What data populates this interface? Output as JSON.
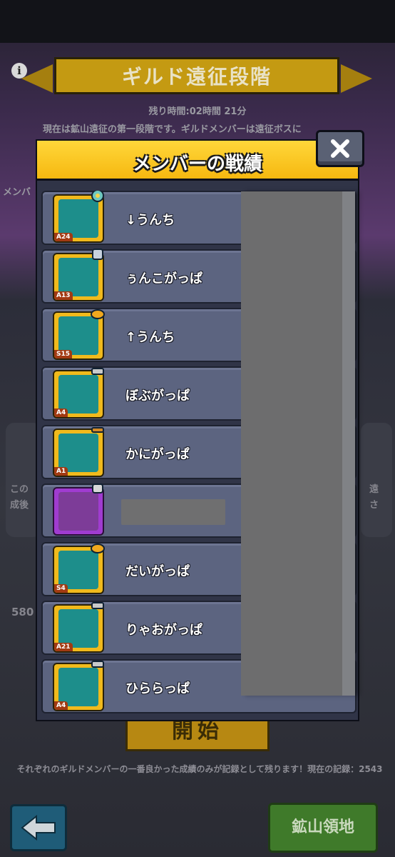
{
  "background": {
    "title": "ギルド遠征段階",
    "time_left": "残り時間:02時間 21分",
    "description": "現在は鉱山遠征の第一段階です。ギルドメンバーは遠征ボスに",
    "side_text": "メンバ",
    "side_text_left": "この\n成後",
    "side_text_right": "遠\nさ",
    "number": "580",
    "start_button": "開始",
    "note": "それぞれのギルドメンバーの一番良かった成績のみが記録として残ります！現在の記録：2543",
    "mine_button": "鉱山領地"
  },
  "modal": {
    "title": "メンバーの戦績",
    "members": [
      {
        "name": "↓うんち",
        "level": "A24",
        "badge": "gear-badge"
      },
      {
        "name": "ぅんこがっぱ",
        "level": "A13",
        "badge": "scroll-badge"
      },
      {
        "name": "↑うんち",
        "level": "S15",
        "badge": "pot-badge"
      },
      {
        "name": "ぼぶがっぱ",
        "level": "A4",
        "badge": "tool-badge"
      },
      {
        "name": "かにがっぱ",
        "level": "A1",
        "badge": "wrench-badge"
      },
      {
        "name": "",
        "level": "",
        "badge": "cat-badge"
      },
      {
        "name": "だいがっぱ",
        "level": "S4",
        "badge": "pot-badge"
      },
      {
        "name": "りゃおがっぱ",
        "level": "A21",
        "badge": "tool-badge"
      },
      {
        "name": "ひららっぱ",
        "level": "A4",
        "badge": "tool-badge"
      }
    ]
  },
  "colors": {
    "header": "#f6b810",
    "row": "#5c6480",
    "avatar": "#f1ba1c",
    "modal": "#303447"
  }
}
